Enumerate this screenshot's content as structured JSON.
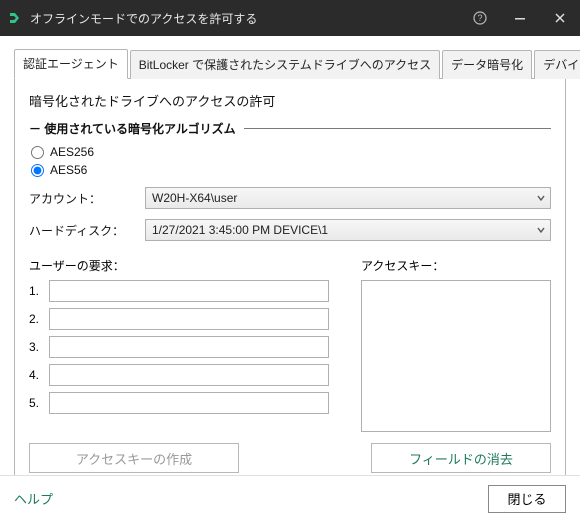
{
  "window": {
    "title": "オフラインモードでのアクセスを許可する"
  },
  "tabs": {
    "t0": "認証エージェント",
    "t1": "BitLocker で保護されたシステムドライブへのアクセス",
    "t2": "データ暗号化",
    "t3": "デバイスコントロール"
  },
  "panel": {
    "sectionTitle": "暗号化されたドライブへのアクセスの許可",
    "groupHeader": "－ 使用されている暗号化アルゴリズム",
    "radio1": "AES256",
    "radio2": "AES56",
    "accountLabel": "アカウント：",
    "accountValue": "W20H-X64\\user",
    "hddLabel": "ハードディスク：",
    "hddValue": "1/27/2021 3:45:00 PM  DEVICE\\1",
    "userReqLabel": "ユーザーの要求：",
    "reqNums": {
      "n1": "1.",
      "n2": "2.",
      "n3": "3.",
      "n4": "4.",
      "n5": "5."
    },
    "accessKeyLabel": "アクセスキー：",
    "createBtn": "アクセスキーの作成",
    "clearBtn": "フィールドの消去"
  },
  "footer": {
    "help": "ヘルプ",
    "close": "閉じる"
  }
}
